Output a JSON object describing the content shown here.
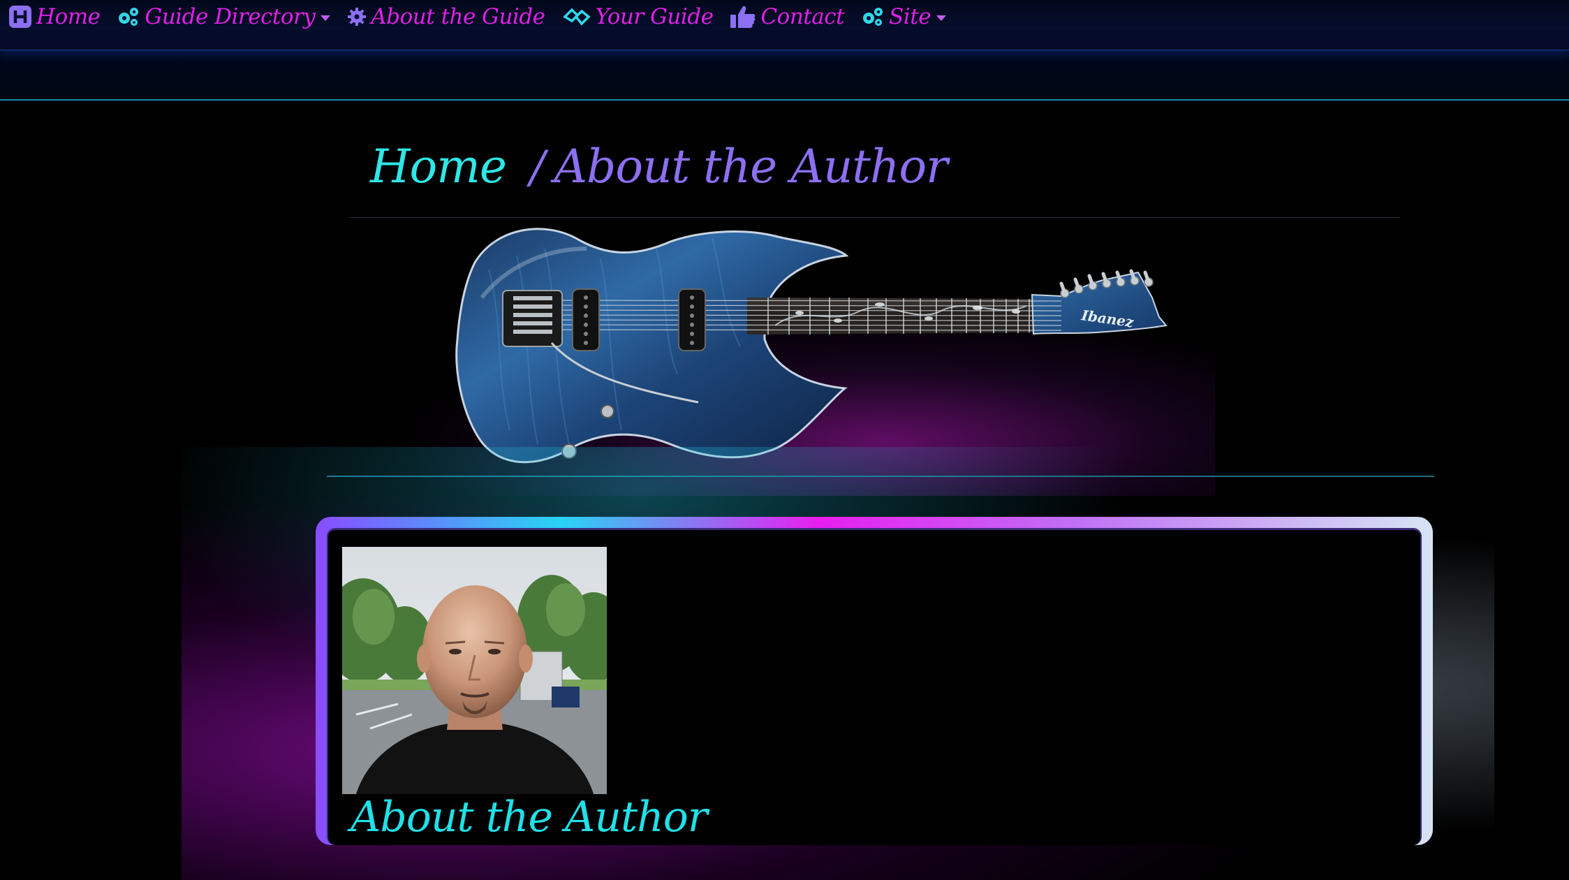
{
  "nav": {
    "items": [
      {
        "label": "Home",
        "icon": "h-square-icon",
        "has_dropdown": false
      },
      {
        "label": "Guide Directory",
        "icon": "gears-icon",
        "has_dropdown": true
      },
      {
        "label": "About the Guide",
        "icon": "gear-icon",
        "has_dropdown": false
      },
      {
        "label": "Your Guide",
        "icon": "diamond-link-icon",
        "has_dropdown": false
      },
      {
        "label": "Contact",
        "icon": "thumbs-up-icon",
        "has_dropdown": false
      },
      {
        "label": "Site",
        "icon": "gears-icon",
        "has_dropdown": true
      }
    ]
  },
  "breadcrumb": {
    "home": "Home",
    "separator": "/",
    "current": "About the Author"
  },
  "hero": {
    "image": "seven-string-guitar",
    "brand_text": "Ibanez"
  },
  "author": {
    "photo": "author-portrait",
    "heading": "About the Author"
  },
  "colors": {
    "nav_magenta": "#e020e8",
    "nav_purple": "#8c6ff2",
    "accent_cyan": "#30e6e6",
    "card_gradient": [
      "#8a4cff",
      "#28d4f4",
      "#e81ef0",
      "#c070f5",
      "#d6e4f4"
    ]
  }
}
